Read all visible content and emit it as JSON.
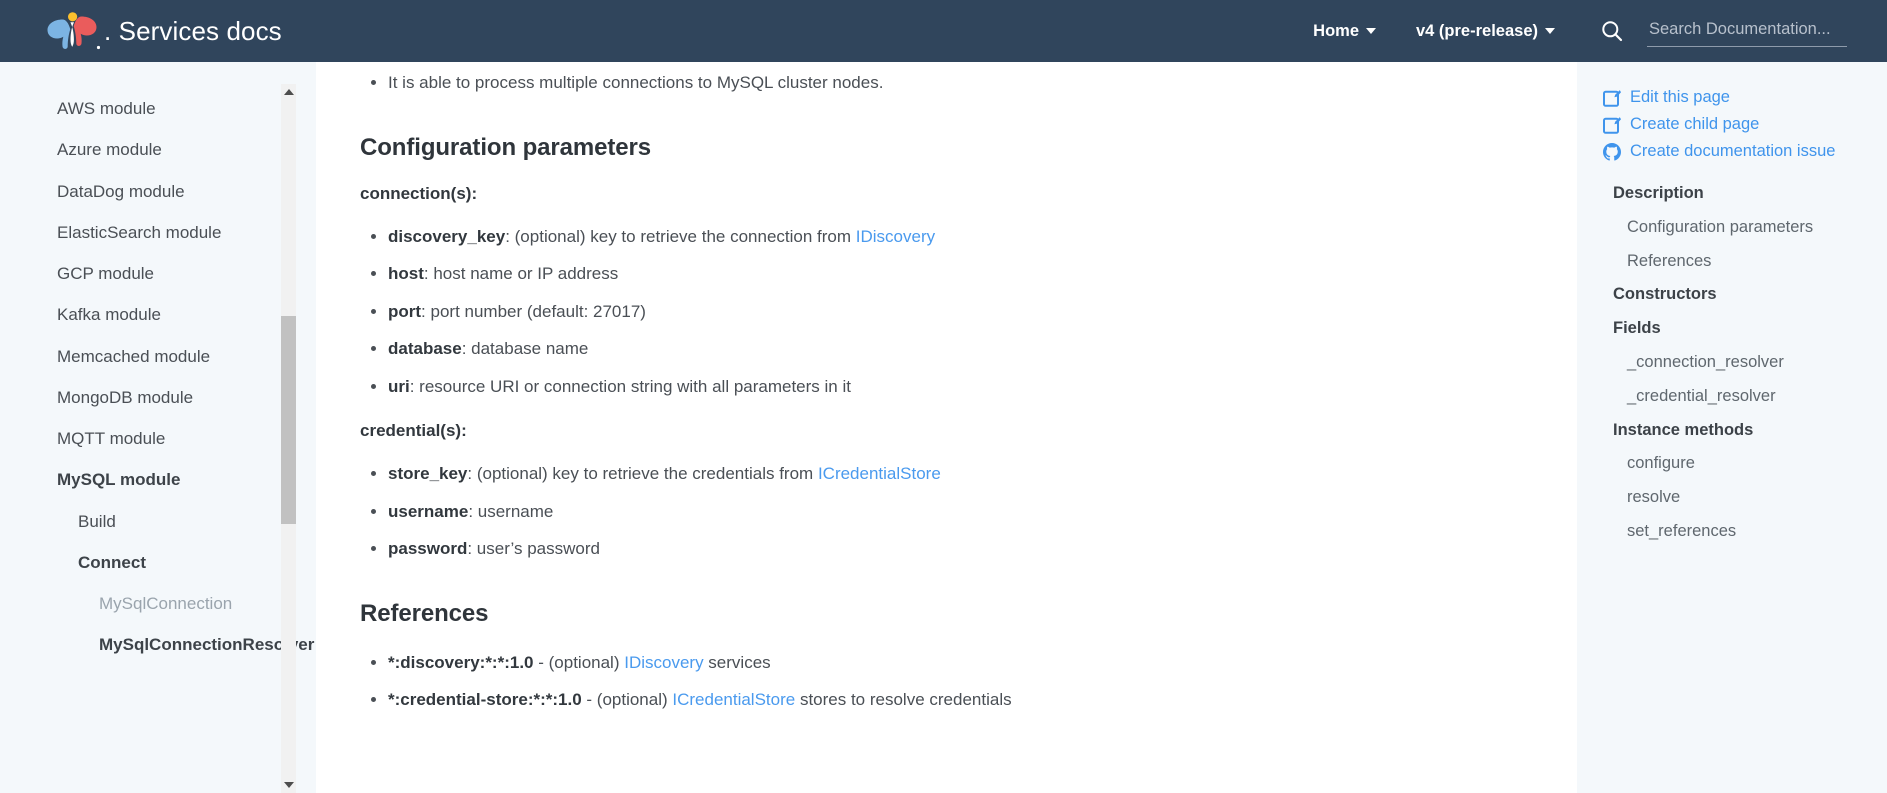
{
  "topnav": {
    "brand_text": ". Services docs",
    "logo_icon": "pip-butterfly-logo",
    "home_label": "Home",
    "version_label": "v4 (pre-release)",
    "search_icon": "search-icon",
    "search_placeholder": "Search Documentation...",
    "search_value": "",
    "bg_color": "#30455c"
  },
  "left_sidebar": {
    "items": [
      {
        "label": "AWS module",
        "level": 0,
        "style": "normal"
      },
      {
        "label": "Azure module",
        "level": 0,
        "style": "normal"
      },
      {
        "label": "DataDog module",
        "level": 0,
        "style": "normal"
      },
      {
        "label": "ElasticSearch module",
        "level": 0,
        "style": "normal"
      },
      {
        "label": "GCP module",
        "level": 0,
        "style": "normal"
      },
      {
        "label": "Kafka module",
        "level": 0,
        "style": "normal"
      },
      {
        "label": "Memcached module",
        "level": 0,
        "style": "normal"
      },
      {
        "label": "MongoDB module",
        "level": 0,
        "style": "normal"
      },
      {
        "label": "MQTT module",
        "level": 0,
        "style": "normal"
      },
      {
        "label": "MySQL module",
        "level": 0,
        "style": "bold"
      },
      {
        "label": "Build",
        "level": 1,
        "style": "normal"
      },
      {
        "label": "Connect",
        "level": 1,
        "style": "bold"
      },
      {
        "label": "MySqlConnection",
        "level": 2,
        "style": "muted"
      },
      {
        "label": "MySqlConnectionResolver",
        "level": 2,
        "style": "bold"
      }
    ],
    "scrollbar": {
      "up_arrow_icon": "scroll-up-arrow-icon",
      "down_arrow_icon": "scroll-down-arrow-icon"
    }
  },
  "content": {
    "intro_bullets": [
      "It is able to process multiple connections to MySQL cluster nodes."
    ],
    "config_heading": "Configuration parameters",
    "connection_label": "connection(s):",
    "connection_params": [
      {
        "name": "discovery_key",
        "desc": ": (optional) key to retrieve the connection from ",
        "link": "IDiscovery",
        "tail": ""
      },
      {
        "name": "host",
        "desc": ": host name or IP address",
        "link": "",
        "tail": ""
      },
      {
        "name": "port",
        "desc": ": port number (default: 27017)",
        "link": "",
        "tail": ""
      },
      {
        "name": "database",
        "desc": ": database name",
        "link": "",
        "tail": ""
      },
      {
        "name": "uri",
        "desc": ": resource URI or connection string with all parameters in it",
        "link": "",
        "tail": ""
      }
    ],
    "credential_label": "credential(s):",
    "credential_params": [
      {
        "name": "store_key",
        "desc": ": (optional) key to retrieve the credentials from ",
        "link": "ICredentialStore",
        "tail": ""
      },
      {
        "name": "username",
        "desc": ": username",
        "link": "",
        "tail": ""
      },
      {
        "name": "password",
        "desc": ": user’s password",
        "link": "",
        "tail": ""
      }
    ],
    "references_heading": "References",
    "references": [
      {
        "name": "*:discovery:*:*:1.0",
        "desc": " - (optional) ",
        "link": "IDiscovery",
        "tail": " services"
      },
      {
        "name": "*:credential-store:*:*:1.0",
        "desc": " - (optional) ",
        "link": "ICredentialStore",
        "tail": " stores to resolve credentials"
      }
    ],
    "link_color": "#4a9aee"
  },
  "right_sidebar": {
    "actions": [
      {
        "label": "Edit this page",
        "icon": "pencil-square-icon"
      },
      {
        "label": "Create child page",
        "icon": "pencil-square-icon"
      },
      {
        "label": "Create documentation issue",
        "icon": "github-icon"
      }
    ],
    "toc": [
      {
        "label": "Description",
        "level": 2
      },
      {
        "label": "Configuration parameters",
        "level": 3
      },
      {
        "label": "References",
        "level": 3
      },
      {
        "label": "Constructors",
        "level": 2
      },
      {
        "label": "Fields",
        "level": 2
      },
      {
        "label": "_connection_resolver",
        "level": 3
      },
      {
        "label": "_credential_resolver",
        "level": 3
      },
      {
        "label": "Instance methods",
        "level": 2
      },
      {
        "label": "configure",
        "level": 3
      },
      {
        "label": "resolve",
        "level": 3
      },
      {
        "label": "set_references",
        "level": 3
      }
    ]
  }
}
